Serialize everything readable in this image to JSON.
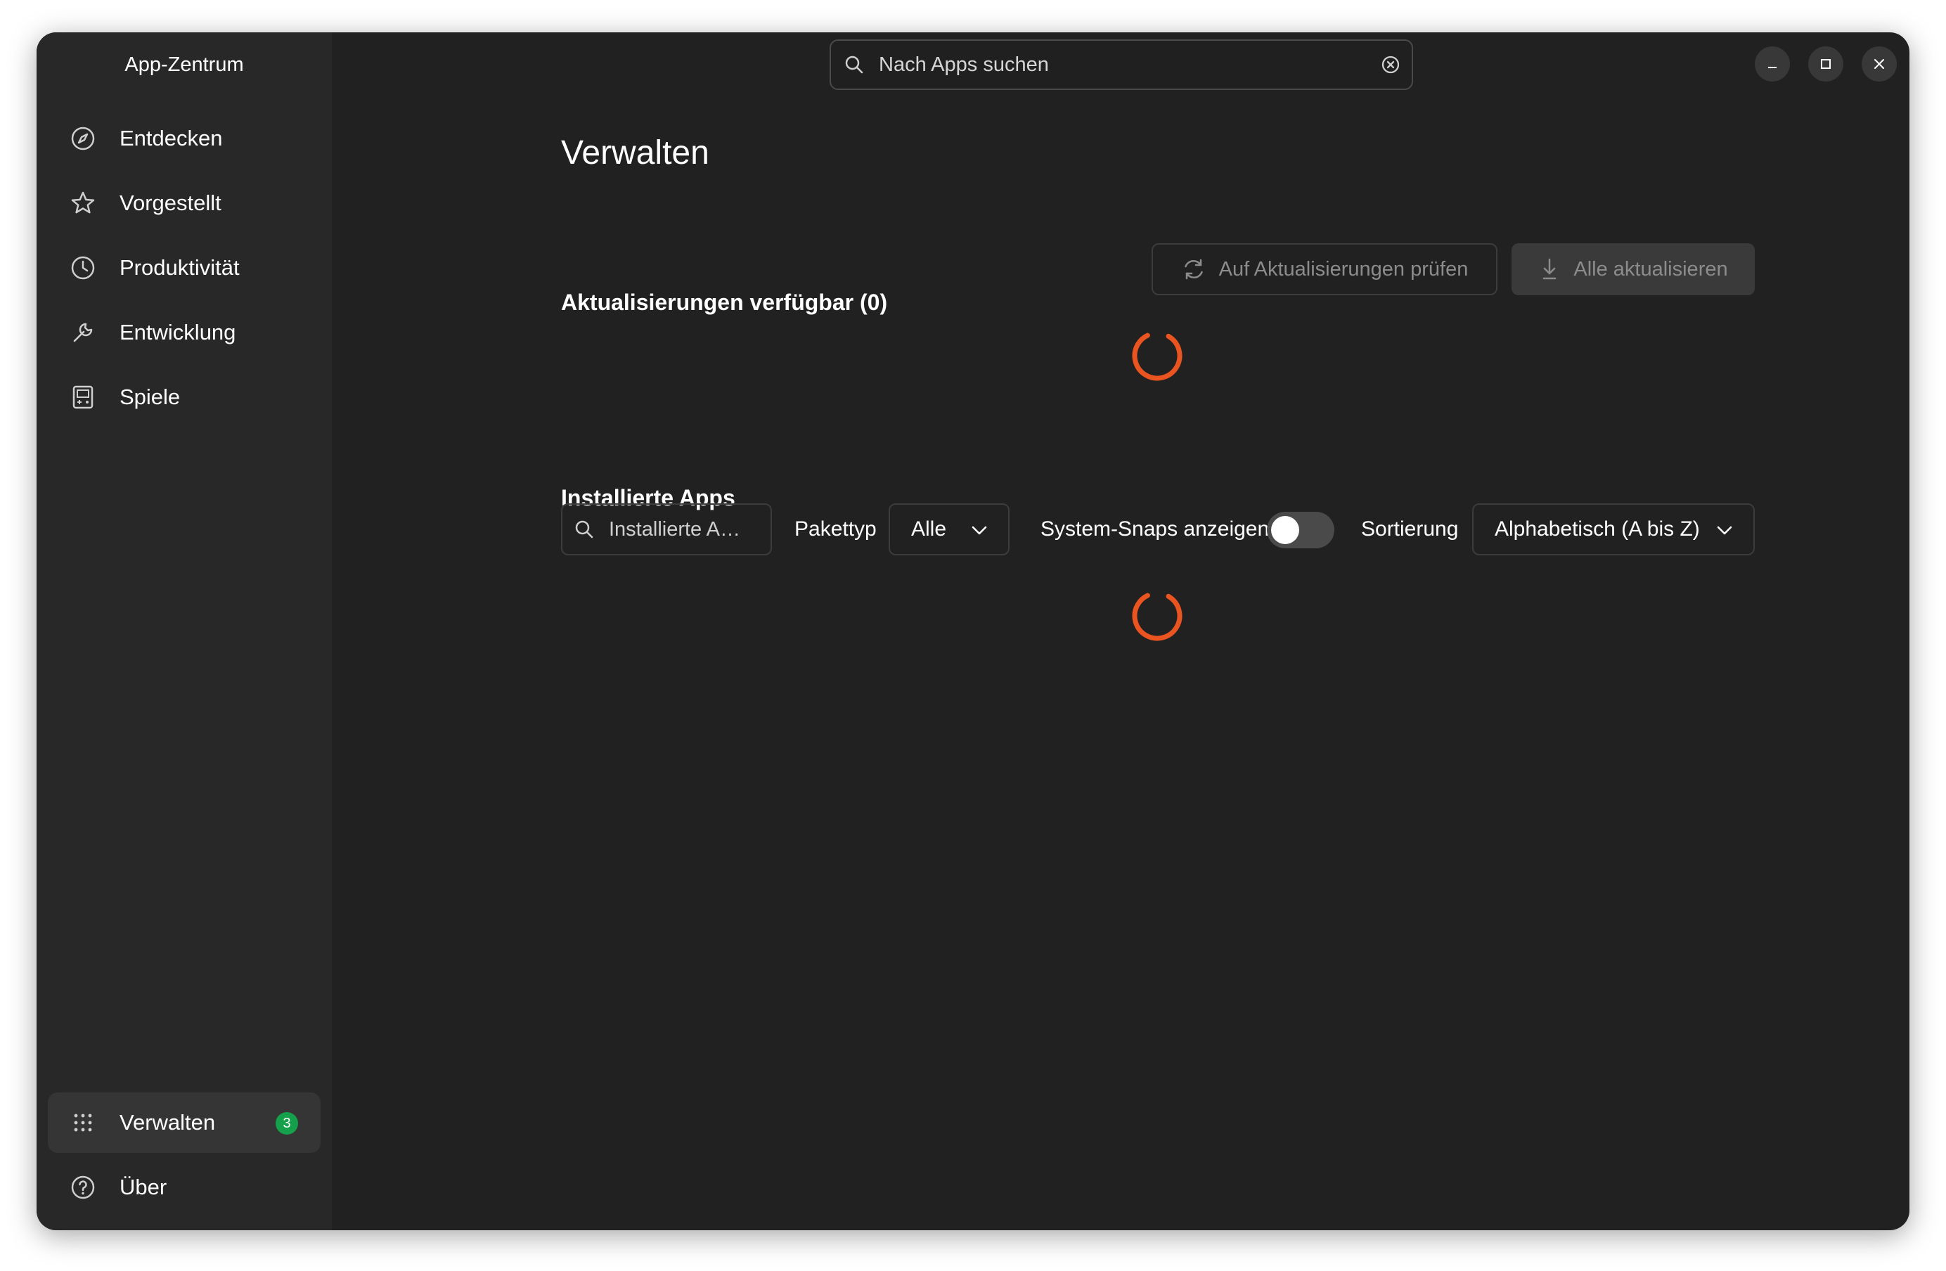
{
  "app": {
    "title": "App-Zentrum"
  },
  "colors": {
    "accent": "#E95420",
    "badge": "#15A04B",
    "window_bg": "#212121",
    "sidebar_bg": "#282828"
  },
  "sidebar": {
    "items": [
      {
        "label": "Entdecken",
        "icon": "compass-icon"
      },
      {
        "label": "Vorgestellt",
        "icon": "star-icon"
      },
      {
        "label": "Produktivität",
        "icon": "clock-icon"
      },
      {
        "label": "Entwicklung",
        "icon": "wrench-icon"
      },
      {
        "label": "Spiele",
        "icon": "game-icon"
      }
    ],
    "bottom": [
      {
        "label": "Verwalten",
        "icon": "grid-icon",
        "badge": "3",
        "active": true
      },
      {
        "label": "Über",
        "icon": "help-icon"
      }
    ]
  },
  "search": {
    "placeholder": "Nach Apps suchen"
  },
  "main": {
    "title": "Verwalten",
    "updates": {
      "title": "Aktualisierungen verfügbar (0)",
      "check_label": "Auf Aktualisierungen prüfen",
      "update_all_label": "Alle aktualisieren"
    },
    "installed": {
      "title": "Installierte Apps",
      "search_placeholder": "Installierte A…",
      "package_type_label": "Pakettyp",
      "package_type_value": "Alle",
      "system_snaps_label": "System-Snaps anzeigen",
      "system_snaps_on": false,
      "sort_label": "Sortierung",
      "sort_value": "Alphabetisch (A bis Z)"
    }
  }
}
